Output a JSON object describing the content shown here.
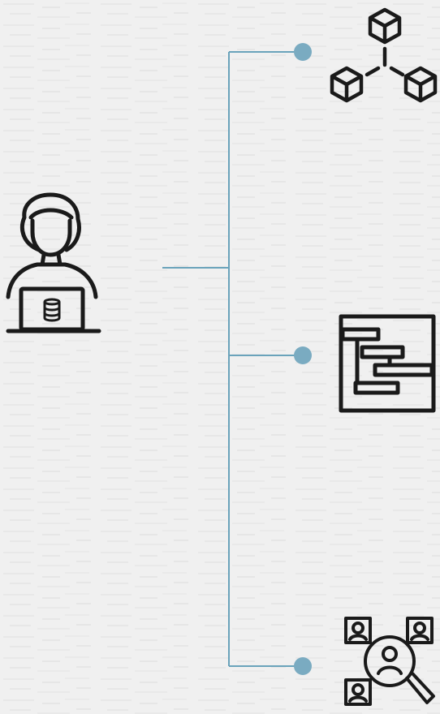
{
  "colors": {
    "background": "#f0f0f0",
    "connector": "#6aa3bb",
    "node_dot": "#7aabc1",
    "icon_stroke": "#1a1a1a"
  },
  "icons": {
    "source": "data-analyst-icon",
    "branches": [
      "network-cubes-icon",
      "gantt-chart-icon",
      "people-search-icon"
    ]
  }
}
